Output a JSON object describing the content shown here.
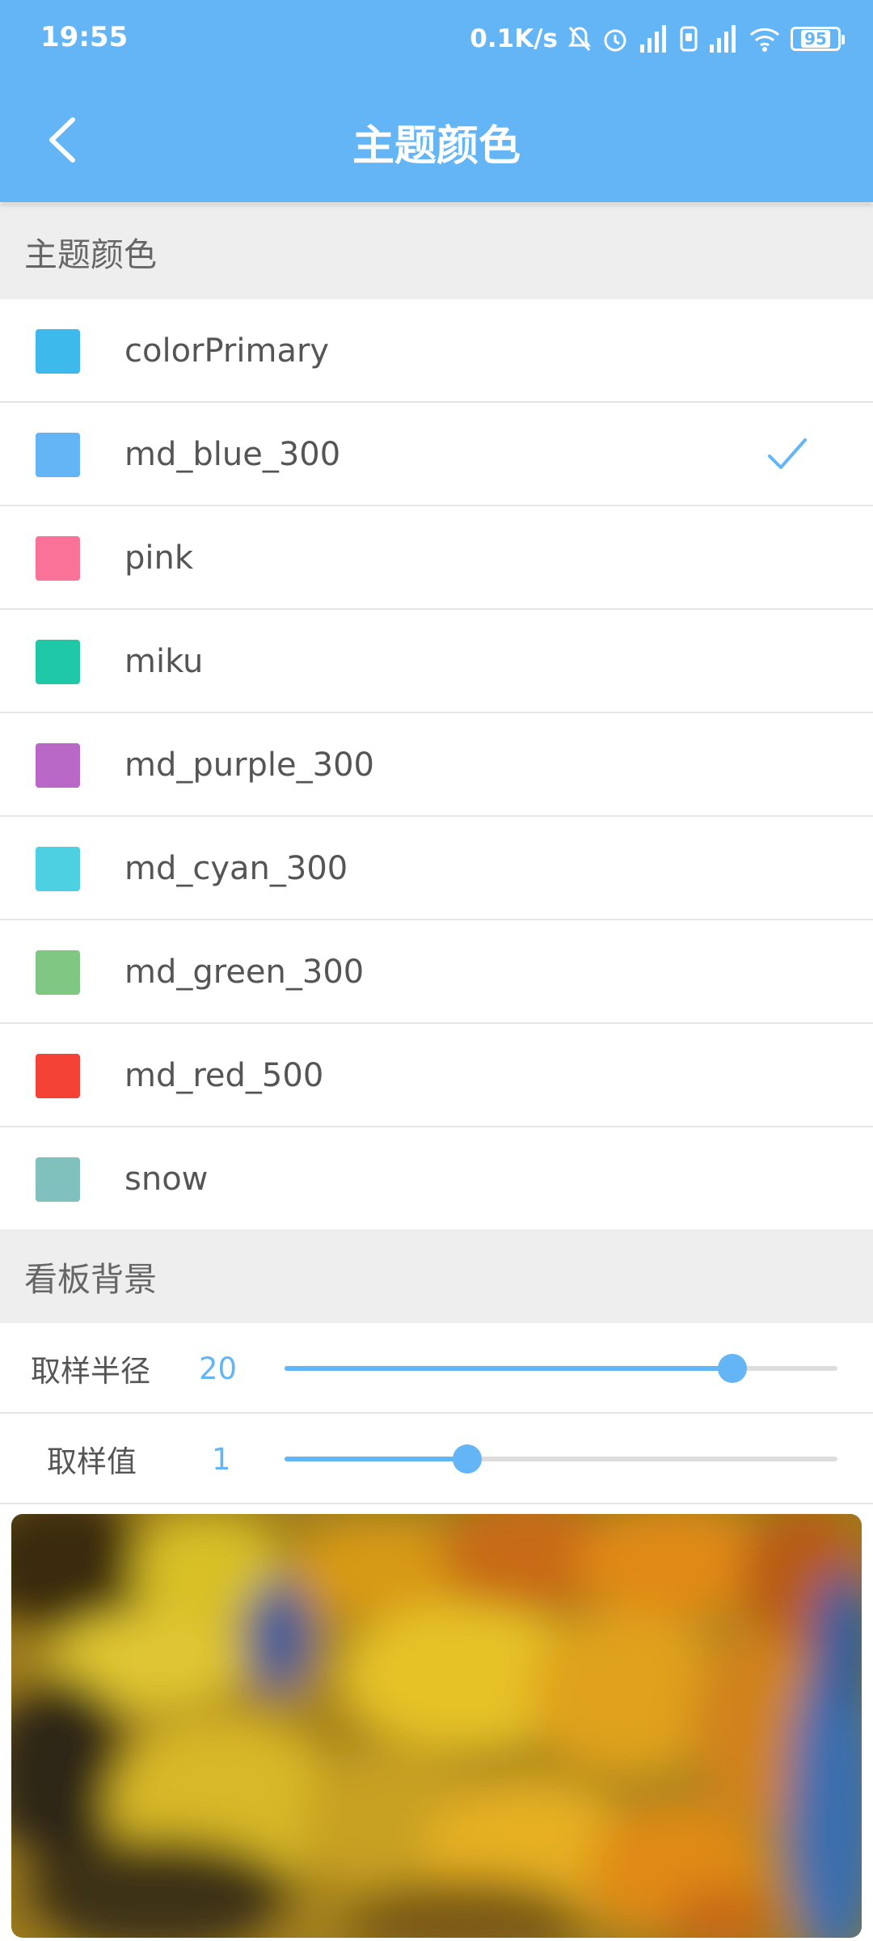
{
  "status_bar": {
    "time": "19:55",
    "net_speed": "0.1K/s",
    "battery": "95",
    "icons": [
      "mute-bell-icon",
      "alarm-icon",
      "signal-icon",
      "volte-icon",
      "signal-icon",
      "wifi-icon",
      "battery-icon"
    ]
  },
  "toolbar": {
    "title": "主题颜色",
    "back_icon": "chevron-left-icon"
  },
  "theme_section": {
    "header": "主题颜色",
    "items": [
      {
        "label": "colorPrimary",
        "color": "#3DB9EB",
        "selected": false
      },
      {
        "label": "md_blue_300",
        "color": "#64B5F6",
        "selected": true
      },
      {
        "label": "pink",
        "color": "#FB7299",
        "selected": false
      },
      {
        "label": "miku",
        "color": "#1FC9A7",
        "selected": false
      },
      {
        "label": "md_purple_300",
        "color": "#BA68C8",
        "selected": false
      },
      {
        "label": "md_cyan_300",
        "color": "#4DD0E1",
        "selected": false
      },
      {
        "label": "md_green_300",
        "color": "#81C784",
        "selected": false
      },
      {
        "label": "md_red_500",
        "color": "#F44336",
        "selected": false
      },
      {
        "label": "snow",
        "color": "#80C1BD",
        "selected": false
      }
    ]
  },
  "board_section": {
    "header": "看板背景",
    "sliders": [
      {
        "label": "取样半径",
        "value": "20",
        "fraction": 0.81
      },
      {
        "label": "取样值",
        "value": "1",
        "fraction": 0.33
      }
    ]
  },
  "accent_color": "#64B5F6"
}
